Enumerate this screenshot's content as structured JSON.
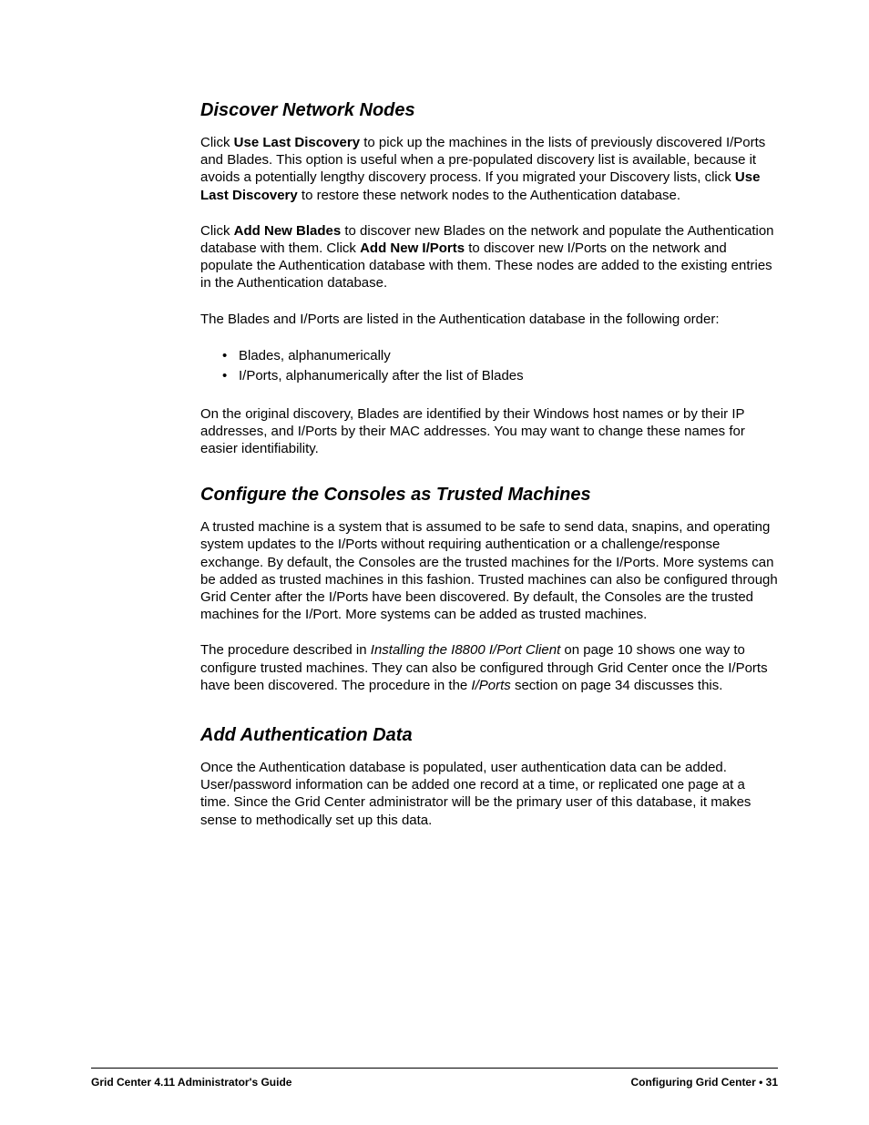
{
  "section1": {
    "heading": "Discover Network Nodes",
    "p1_a": "Click ",
    "p1_b": "Use Last Discovery",
    "p1_c": " to pick up the machines in the lists of previously discovered I/Ports and Blades. This option is useful when a pre-populated discovery list is available, because it avoids a potentially lengthy discovery process. If you migrated your Discovery lists, click ",
    "p1_d": "Use Last Discovery",
    "p1_e": " to restore these network nodes to the Authentication database.",
    "p2_a": "Click ",
    "p2_b": "Add New Blades",
    "p2_c": " to discover new Blades on the network and populate the Authentication database with them. Click ",
    "p2_d": "Add New I/Ports",
    "p2_e": " to discover new I/Ports on the network and populate the Authentication database with them. These nodes are added to the existing entries in the Authentication database.",
    "p3": "The Blades and I/Ports are listed in the Authentication database in the following order:",
    "li1": "Blades, alphanumerically",
    "li2": "I/Ports, alphanumerically after the list of Blades",
    "p4": "On the original discovery, Blades are identified by their Windows host names or by their IP addresses, and I/Ports by their MAC addresses. You may want to change these names for easier identifiability."
  },
  "section2": {
    "heading": "Configure the Consoles as Trusted Machines",
    "p1": "A trusted machine is a system that is assumed to be safe to send data, snapins, and operating system updates to the I/Ports without requiring authentication or a challenge/response exchange. By default, the Consoles are the trusted machines for the I/Ports. More systems can be added as trusted machines in this fashion. Trusted machines can also be configured through Grid Center after the I/Ports have been discovered. By default, the Consoles are the trusted machines for the I/Port. More systems can be added as trusted machines.",
    "p2_a": "The procedure described in ",
    "p2_b": "Installing the I8800 I/Port Client",
    "p2_c": " on page 10 shows one way to configure trusted machines. They can also be configured through Grid Center once the I/Ports have been discovered. The procedure in the ",
    "p2_d": "I/Ports",
    "p2_e": " section on page 34 discusses this."
  },
  "section3": {
    "heading": "Add Authentication Data",
    "p1": "Once the Authentication database is populated, user authentication data can be added. User/password information can be added one record at a time, or replicated one page at a time. Since the Grid Center administrator will be the primary user of this database, it makes sense to methodically set up this data."
  },
  "footer": {
    "left": "Grid Center 4.11 Administrator's Guide",
    "right": "Configuring Grid Center • 31"
  }
}
